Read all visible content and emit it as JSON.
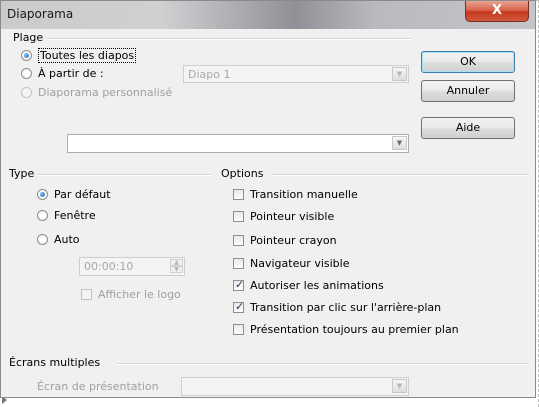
{
  "window": {
    "title": "Diaporama",
    "close_glyph": "X"
  },
  "plage": {
    "label": "Plage",
    "options": [
      {
        "label": "Toutes les diapos",
        "selected": true,
        "enabled": true
      },
      {
        "label": "À partir de :",
        "selected": false,
        "enabled": true
      },
      {
        "label": "Diaporama personnalisé",
        "selected": false,
        "enabled": false
      }
    ],
    "start_slide": {
      "value": "Diapo 1",
      "enabled": false
    },
    "custom_show": {
      "value": "",
      "enabled": true
    }
  },
  "type": {
    "label": "Type",
    "options": [
      {
        "label": "Par défaut",
        "selected": true
      },
      {
        "label": "Fenêtre",
        "selected": false
      },
      {
        "label": "Auto",
        "selected": false
      }
    ],
    "pause": {
      "value": "00:00:10",
      "enabled": false
    },
    "show_logo": {
      "label": "Afficher le logo",
      "checked": false,
      "enabled": false
    }
  },
  "options": {
    "label": "Options",
    "items": [
      {
        "label": "Transition manuelle",
        "checked": false
      },
      {
        "label": "Pointeur visible",
        "checked": false
      },
      {
        "label": "Pointeur crayon",
        "checked": false
      },
      {
        "label": "Navigateur visible",
        "checked": false
      },
      {
        "label": "Autoriser les animations",
        "checked": true
      },
      {
        "label": "Transition par clic sur l'arrière-plan",
        "checked": true
      },
      {
        "label": "Présentation toujours au premier plan",
        "checked": false
      }
    ]
  },
  "multiscreen": {
    "label": "Écrans multiples",
    "presentation_screen_label": "Écran de présentation",
    "presentation_screen_value": ""
  },
  "buttons": {
    "ok": "OK",
    "cancel": "Annuler",
    "help": "Aide"
  },
  "icons": {
    "dropdown": "dropdown-arrow-icon",
    "spin_up": "spin-up-icon",
    "spin_down": "spin-down-icon",
    "check": "checkmark-icon"
  }
}
